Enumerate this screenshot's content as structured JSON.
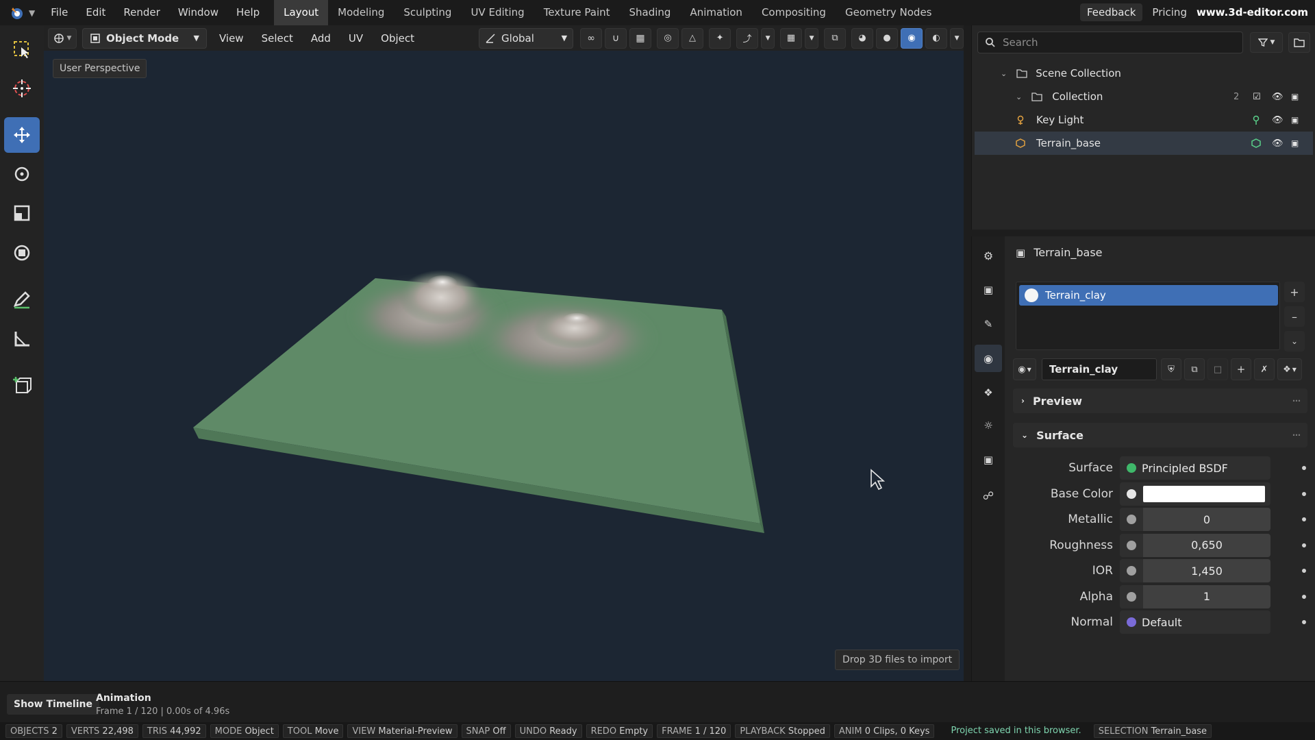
{
  "menu": {
    "items": [
      "File",
      "Edit",
      "Render",
      "Window",
      "Help"
    ]
  },
  "workspaces": {
    "tabs": [
      "Layout",
      "Modeling",
      "Sculpting",
      "UV Editing",
      "Texture Paint",
      "Shading",
      "Animation",
      "Compositing",
      "Geometry Nodes"
    ],
    "active": "Layout"
  },
  "topright": {
    "feedback": "Feedback",
    "pricing": "Pricing",
    "site": "www.3d-editor.com"
  },
  "header": {
    "mode": "Object Mode",
    "menus": [
      "View",
      "Select",
      "Add",
      "UV",
      "Object"
    ],
    "orientation": "Global"
  },
  "viewport": {
    "perspective_label": "User Perspective",
    "drop_hint": "Drop 3D files to import"
  },
  "outliner": {
    "search_placeholder": "Search",
    "scene_collection": "Scene Collection",
    "collection": "Collection",
    "collection_count": "2",
    "objects": [
      {
        "name": "Key Light"
      },
      {
        "name": "Terrain_base"
      }
    ]
  },
  "properties": {
    "object_name": "Terrain_base",
    "material_slot": "Terrain_clay",
    "material_name": "Terrain_clay",
    "sections": {
      "preview": "Preview",
      "surface": "Surface"
    },
    "fields": [
      {
        "label": "Surface",
        "value": "Principled BSDF",
        "socket_color": "#3fb86a",
        "kind": "shader"
      },
      {
        "label": "Base Color",
        "value": "",
        "socket_color": "#e6e6e6",
        "kind": "color"
      },
      {
        "label": "Metallic",
        "value": "0",
        "socket_color": "#a0a0a0",
        "kind": "number"
      },
      {
        "label": "Roughness",
        "value": "0,650",
        "socket_color": "#a0a0a0",
        "kind": "number"
      },
      {
        "label": "IOR",
        "value": "1,450",
        "socket_color": "#a0a0a0",
        "kind": "number"
      },
      {
        "label": "Alpha",
        "value": "1",
        "socket_color": "#a0a0a0",
        "kind": "number"
      },
      {
        "label": "Normal",
        "value": "Default",
        "socket_color": "#7a6bd8",
        "kind": "vector"
      }
    ]
  },
  "timeline": {
    "button": "Show Timeline",
    "title": "Animation",
    "subtitle": "Frame 1 / 120 | 0.00s of 4.96s"
  },
  "status": {
    "chips": [
      {
        "k": "OBJECTS",
        "v": "2"
      },
      {
        "k": "VERTS",
        "v": "22,498"
      },
      {
        "k": "TRIS",
        "v": "44,992"
      },
      {
        "k": "MODE",
        "v": "Object"
      },
      {
        "k": "TOOL",
        "v": "Move"
      },
      {
        "k": "VIEW",
        "v": "Material-Preview"
      },
      {
        "k": "SNAP",
        "v": "Off"
      },
      {
        "k": "UNDO",
        "v": "Ready"
      },
      {
        "k": "REDO",
        "v": "Empty"
      },
      {
        "k": "FRAME",
        "v": "1 / 120"
      },
      {
        "k": "PLAYBACK",
        "v": "Stopped"
      },
      {
        "k": "ANIM",
        "v": "0 Clips, 0 Keys"
      }
    ],
    "saved": "Project saved in this browser.",
    "selection_key": "SELECTION",
    "selection_val": "Terrain_base"
  },
  "colors": {
    "accent": "#3f6fb5",
    "terrain": "#5f8a67",
    "viewport_bg": "#1c2633"
  }
}
